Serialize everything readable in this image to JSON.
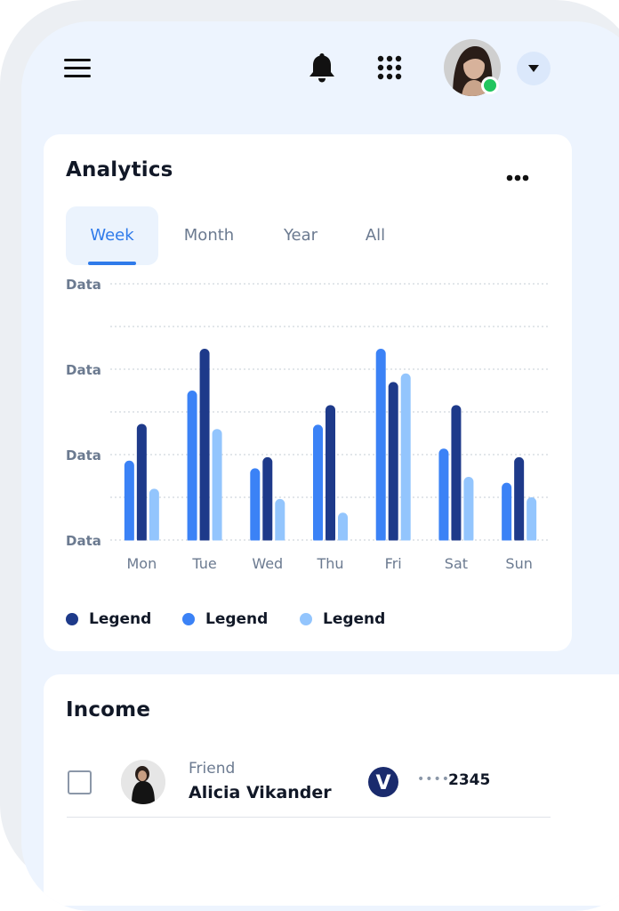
{
  "header": {
    "icons": [
      "menu-icon",
      "bell-icon",
      "apps-grid-icon",
      "chevron-down-icon"
    ],
    "avatar_status": "online"
  },
  "analytics": {
    "title": "Analytics",
    "tabs": [
      {
        "label": "Week",
        "active": true
      },
      {
        "label": "Month",
        "active": false
      },
      {
        "label": "Year",
        "active": false
      },
      {
        "label": "All",
        "active": false
      }
    ]
  },
  "chart_data": {
    "type": "bar",
    "categories": [
      "Mon",
      "Tue",
      "Wed",
      "Thu",
      "Fri",
      "Sat",
      "Sun"
    ],
    "y_tick_labels": [
      "Data",
      "Data",
      "Data",
      "Data"
    ],
    "ylim": [
      0,
      3
    ],
    "grid": true,
    "legend_position": "bottom",
    "series": [
      {
        "name": "Legend",
        "color": "#3b82f6",
        "values": [
          0.93,
          1.75,
          0.84,
          1.35,
          2.24,
          1.07,
          0.67
        ]
      },
      {
        "name": "Legend",
        "color": "#1e3a8a",
        "values": [
          1.36,
          2.24,
          0.97,
          1.58,
          1.85,
          1.58,
          0.97
        ]
      },
      {
        "name": "Legend",
        "color": "#93c5fd",
        "values": [
          0.6,
          1.3,
          0.48,
          0.32,
          1.95,
          0.74,
          0.5
        ]
      }
    ]
  },
  "legend": {
    "items": [
      {
        "label": "Legend",
        "color": "#1e3a8a"
      },
      {
        "label": "Legend",
        "color": "#3b82f6"
      },
      {
        "label": "Legend",
        "color": "#93c5fd"
      }
    ]
  },
  "income": {
    "title": "Income",
    "rows": [
      {
        "subtitle": "Friend",
        "name": "Alicia Vikander",
        "card_brand": "V",
        "card_mask": "••••",
        "card_last4": "2345"
      }
    ]
  }
}
